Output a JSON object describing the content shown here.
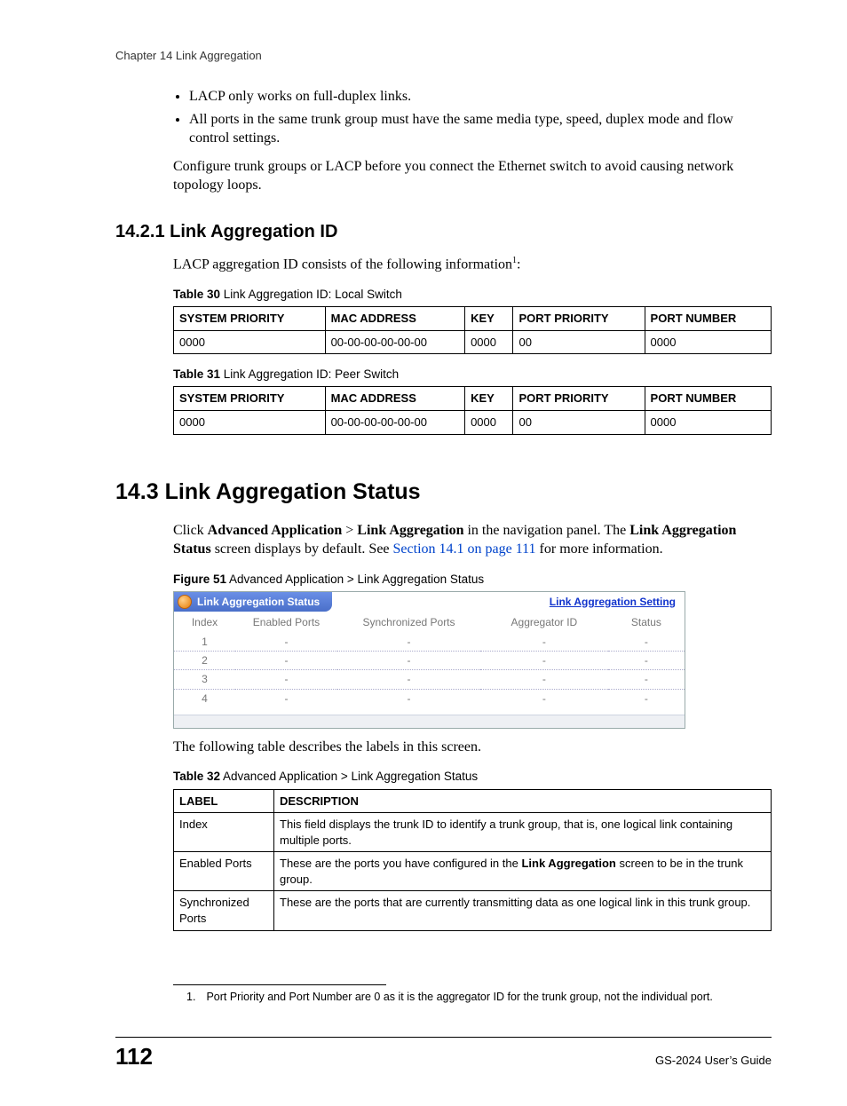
{
  "header": "Chapter 14 Link Aggregation",
  "intro": {
    "bullet1": "LACP only works on full-duplex links.",
    "bullet2": "All ports in the same trunk group must have the same media type, speed, duplex mode and flow control settings.",
    "para": "Configure trunk groups or LACP before you connect the Ethernet switch to avoid causing network topology loops."
  },
  "s1421": {
    "heading": "14.2.1  Link Aggregation ID",
    "lead_pref": "LACP aggregation ID consists of the following information",
    "lead_suf": ":",
    "table30": {
      "caption_b": "Table 30",
      "caption_t": "   Link Aggregation ID: Local Switch",
      "h1": "SYSTEM PRIORITY",
      "h2": "MAC ADDRESS",
      "h3": "KEY",
      "h4": "PORT PRIORITY",
      "h5": "PORT NUMBER",
      "c1": "0000",
      "c2": "00-00-00-00-00-00",
      "c3": "0000",
      "c4": "00",
      "c5": "0000"
    },
    "table31": {
      "caption_b": "Table 31",
      "caption_t": "   Link Aggregation ID: Peer Switch",
      "h1": "SYSTEM PRIORITY",
      "h2": "MAC ADDRESS",
      "h3": "KEY",
      "h4": "PORT PRIORITY",
      "h5": "PORT NUMBER",
      "c1": "0000",
      "c2": "00-00-00-00-00-00",
      "c3": "0000",
      "c4": "00",
      "c5": "0000"
    }
  },
  "s143": {
    "heading": "14.3  Link Aggregation Status",
    "p1a": "Click ",
    "p1b": "Advanced Application",
    "p1c": " > ",
    "p1d": "Link Aggregation",
    "p1e": " in the navigation panel. The ",
    "p1f": "Link Aggregation Status",
    "p1g": " screen displays by default. See ",
    "p1link": "Section 14.1 on page 111",
    "p1h": " for more information.",
    "fig": {
      "caption_b": "Figure 51",
      "caption_t": "   Advanced Application > Link Aggregation Status",
      "tab_title": "Link Aggregation Status",
      "setting_link": "Link Aggregation Setting",
      "h1": "Index",
      "h2": "Enabled Ports",
      "h3": "Synchronized Ports",
      "h4": "Aggregator ID",
      "h5": "Status",
      "r1": "1",
      "r2": "2",
      "r3": "3",
      "r4": "4",
      "dash": "-"
    },
    "p2": "The following table describes the labels in this screen.",
    "table32": {
      "caption_b": "Table 32",
      "caption_t": "   Advanced Application > Link Aggregation Status",
      "h1": "LABEL",
      "h2": "DESCRIPTION",
      "r1l": "Index",
      "r1d_a": "This field displays the trunk ID to identify a trunk group, that is, one logical link containing multiple ports.",
      "r2l": "Enabled Ports",
      "r2d_a": "These are the ports you have configured in the ",
      "r2d_b": "Link Aggregation",
      "r2d_c": " screen to be in the trunk group.",
      "r3l": "Synchronized Ports",
      "r3d": "These are the ports that are currently transmitting data as one logical link in this trunk group."
    }
  },
  "footnote": {
    "num": "1.",
    "text": "Port Priority and Port Number are 0 as it is the aggregator ID for the trunk group, not the individual port."
  },
  "footer": {
    "page": "112",
    "guide": "GS-2024 User’s Guide"
  }
}
